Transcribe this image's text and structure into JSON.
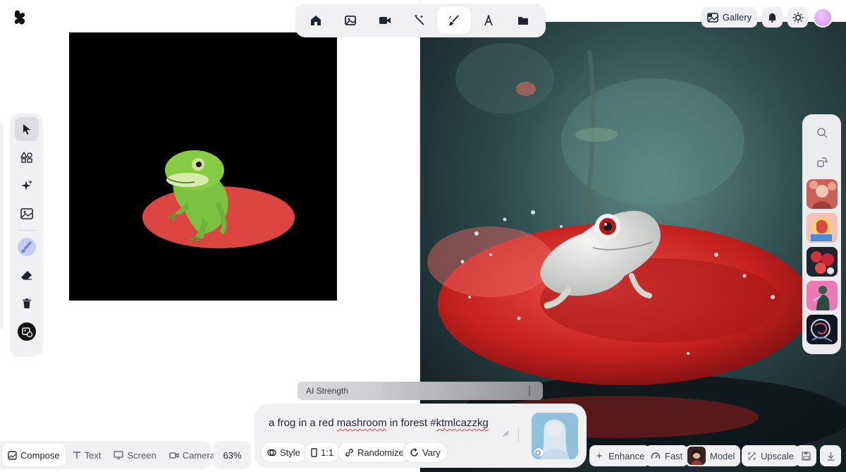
{
  "toolbar": {
    "items": [
      {
        "icon": "home-icon",
        "active": false
      },
      {
        "icon": "image-icon",
        "active": false
      },
      {
        "icon": "video-icon",
        "active": false
      },
      {
        "icon": "magic-wand-icon",
        "active": false
      },
      {
        "icon": "brush-icon",
        "active": true
      },
      {
        "icon": "text-a-icon",
        "active": false
      },
      {
        "icon": "folder-icon",
        "active": false
      }
    ]
  },
  "header": {
    "gallery_label": "Gallery",
    "icons": [
      "bell-icon",
      "sun-icon"
    ]
  },
  "left_tools": [
    "pointer-icon",
    "shapes-icon",
    "sparkles-icon",
    "image-icon",
    "brush-color-icon",
    "eraser-icon",
    "trash-icon",
    "background-remove-icon"
  ],
  "right_tools": [
    "search-icon",
    "rotate-icon"
  ],
  "ai_strength": {
    "label": "AI Strength"
  },
  "prompt": {
    "text_before": "a frog in a red ",
    "text_typo": "mashroom",
    "text_middle": " in forest #",
    "text_typo2": "ktmlcazzkg",
    "chips": {
      "style": "Style",
      "ratio": "1:1",
      "randomize": "Randomize",
      "vary": "Vary"
    }
  },
  "bottom_left": {
    "tabs": [
      {
        "label": "Compose",
        "active": true
      },
      {
        "label": "Text",
        "active": false
      },
      {
        "label": "Screen",
        "active": false
      },
      {
        "label": "Camera",
        "active": false
      }
    ],
    "zoom": "63%"
  },
  "bottom_right": {
    "enhance": "Enhance",
    "fast": "Fast",
    "model": "Model",
    "upscale": "Upscale"
  },
  "colors": {
    "panel_bg": "#f1f1f3",
    "ellipse_red": "#dc4542",
    "frog_green": "#7cc13f"
  }
}
